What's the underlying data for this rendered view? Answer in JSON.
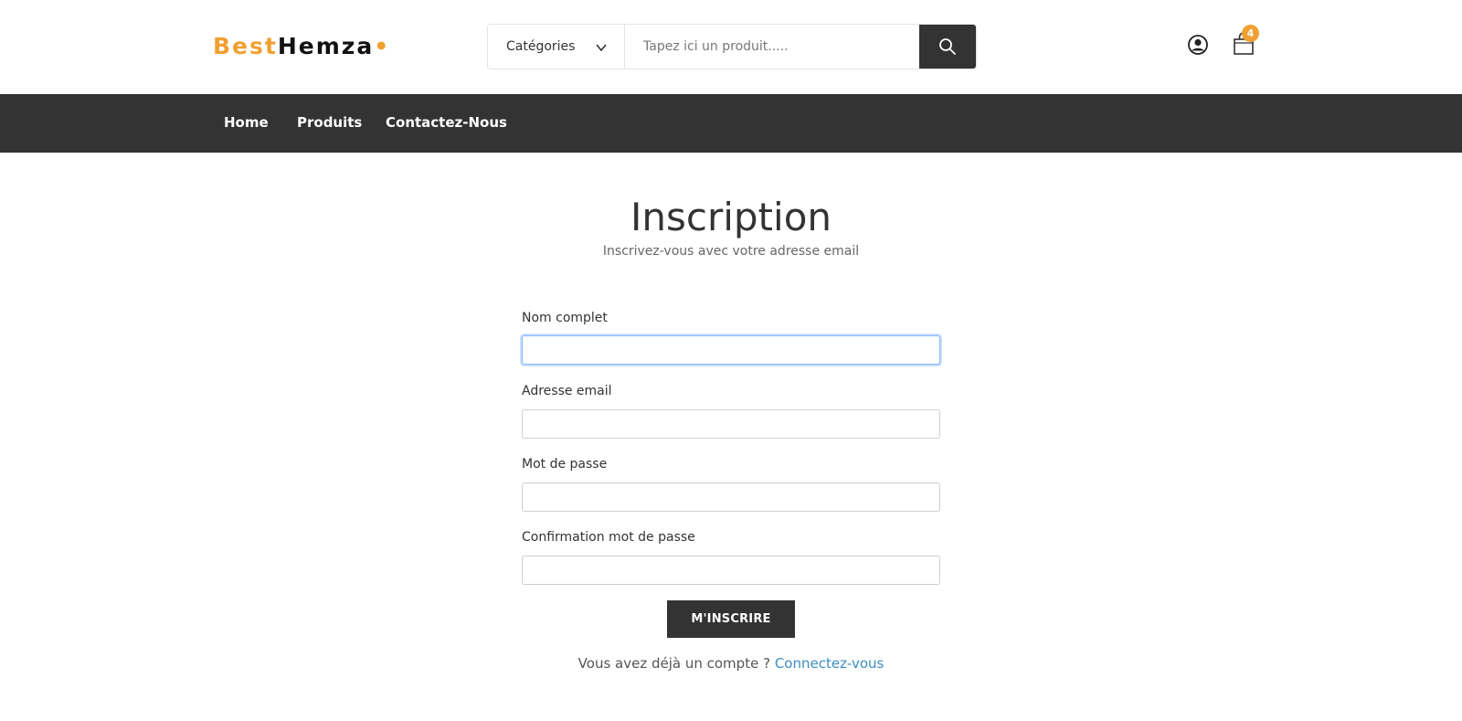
{
  "brand": {
    "part1": "Best",
    "part2": "Hemza",
    "dot": "•",
    "accent_color": "#f0a030"
  },
  "search": {
    "category_label": "Catégories",
    "placeholder": "Tapez ici un produit....."
  },
  "header": {
    "cart_count": "4"
  },
  "nav": {
    "items": [
      "Home",
      "Produits",
      "Contactez-Nous"
    ]
  },
  "page": {
    "title": "Inscription",
    "subtitle": "Inscrivez-vous avec votre adresse email"
  },
  "form": {
    "fields": [
      {
        "label": "Nom complet",
        "value": ""
      },
      {
        "label": "Adresse email",
        "value": ""
      },
      {
        "label": "Mot de passe",
        "value": ""
      },
      {
        "label": "Confirmation mot de passe",
        "value": ""
      }
    ],
    "submit_label": "M'INSCRIRE",
    "login_prompt": "Vous avez déjà un compte ?",
    "login_link": "Connectez-vous"
  }
}
